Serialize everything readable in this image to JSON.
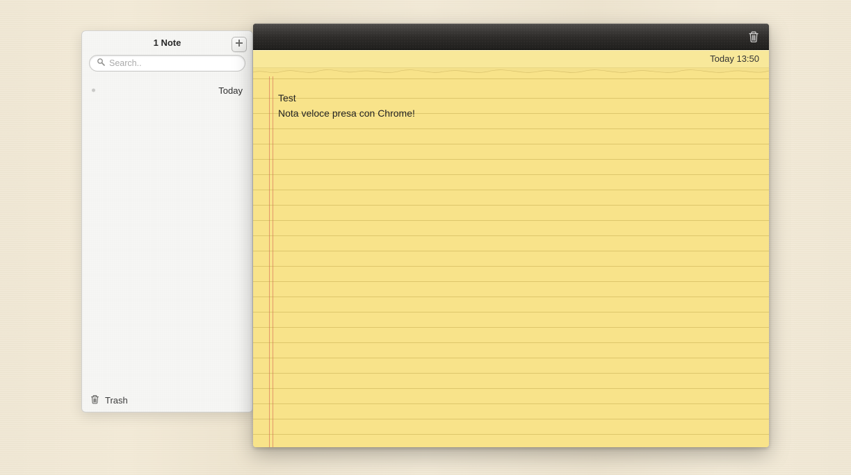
{
  "sidebar": {
    "title": "1 Note",
    "search_placeholder": "Search..",
    "items": [
      {
        "date": "Today"
      }
    ],
    "trash_label": "Trash"
  },
  "note": {
    "timestamp": "Today 13:50",
    "lines": [
      "Test",
      "Nota veloce presa con Chrome!"
    ]
  }
}
